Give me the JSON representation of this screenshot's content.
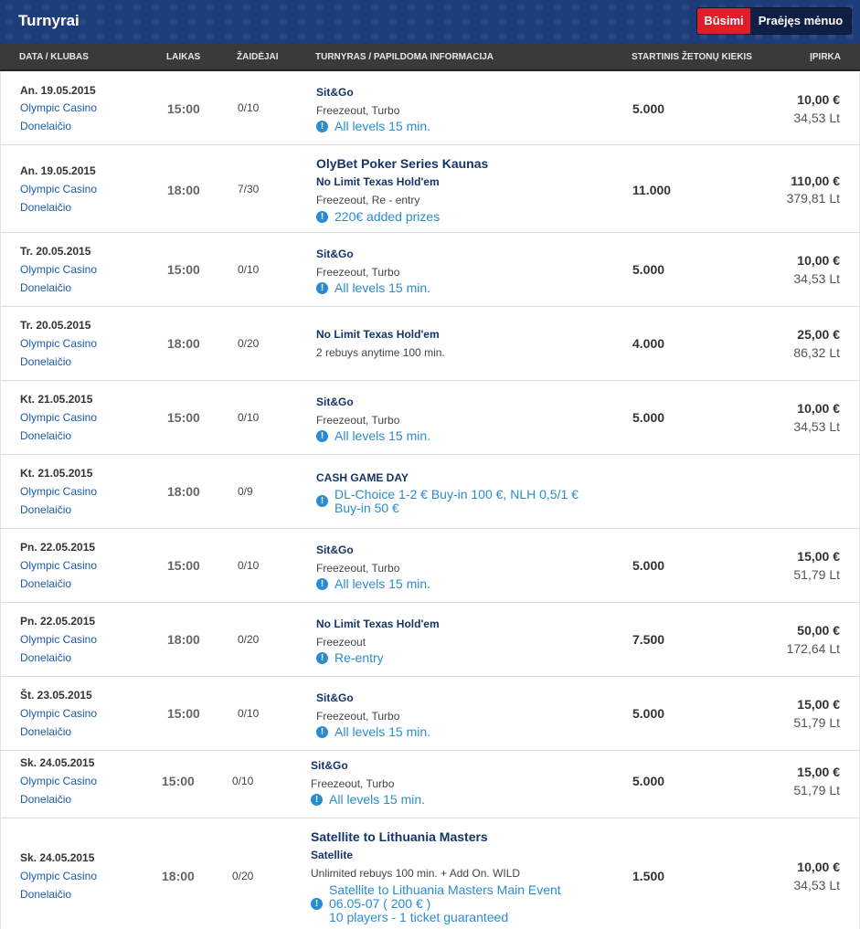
{
  "header": {
    "title": "Turnyrai",
    "tab_upcoming": "Būsimi",
    "tab_past": "Praėjęs mėnuo"
  },
  "columns": {
    "date_club": "DATA / KLUBAS",
    "time": "LAIKAS",
    "players": "ŽAIDĖJAI",
    "tournament": "TURNYRAS / PAPILDOMA INFORMACIJA",
    "chips": "STARTINIS ŽETONŲ KIEKIS",
    "buyin": "ĮPIRKA"
  },
  "rows": [
    {
      "date": "An. 19.05.2015",
      "club": "Olympic Casino",
      "street": "Donelaičio",
      "time": "15:00",
      "players": "0/10",
      "name": "Sit&Go",
      "details": "Freezeout, Turbo",
      "info": "All levels 15 min.",
      "chips": "5.000",
      "eur": "10,00 €",
      "lt": "34,53 Lt"
    },
    {
      "date": "An. 19.05.2015",
      "club": "Olympic Casino",
      "street": "Donelaičio",
      "time": "18:00",
      "players": "7/30",
      "big_title": "OlyBet Poker Series Kaunas",
      "name": "No Limit Texas Hold'em",
      "details": "Freezeout, Re - entry",
      "info": "220€ added prizes",
      "chips": "11.000",
      "eur": "110,00 €",
      "lt": "379,81 Lt"
    },
    {
      "date": "Tr. 20.05.2015",
      "club": "Olympic Casino",
      "street": "Donelaičio",
      "time": "15:00",
      "players": "0/10",
      "name": "Sit&Go",
      "details": "Freezeout, Turbo",
      "info": "All levels 15 min.",
      "chips": "5.000",
      "eur": "10,00 €",
      "lt": "34,53 Lt"
    },
    {
      "date": "Tr. 20.05.2015",
      "club": "Olympic Casino",
      "street": "Donelaičio",
      "time": "18:00",
      "players": "0/20",
      "name": "No Limit Texas Hold'em",
      "details": "2 rebuys anytime 100 min.",
      "chips": "4.000",
      "eur": "25,00 €",
      "lt": "86,32 Lt"
    },
    {
      "date": "Kt. 21.05.2015",
      "club": "Olympic Casino",
      "street": "Donelaičio",
      "time": "15:00",
      "players": "0/10",
      "name": "Sit&Go",
      "details": "Freezeout, Turbo",
      "info": "All levels 15 min.",
      "chips": "5.000",
      "eur": "10,00 €",
      "lt": "34,53 Lt"
    },
    {
      "date": "Kt. 21.05.2015",
      "club": "Olympic Casino",
      "street": "Donelaičio",
      "time": "18:00",
      "players": "0/9",
      "name": "CASH GAME DAY",
      "info_line1": "DL-Choice 1-2 € Buy-in 100 €, NLH 0,5/1 €",
      "info_line2": "Buy-in 50 €"
    },
    {
      "date": "Pn. 22.05.2015",
      "club": "Olympic Casino",
      "street": "Donelaičio",
      "time": "15:00",
      "players": "0/10",
      "name": "Sit&Go",
      "details": "Freezeout, Turbo",
      "info": "All levels 15 min.",
      "chips": "5.000",
      "eur": "15,00 €",
      "lt": "51,79 Lt"
    },
    {
      "date": "Pn. 22.05.2015",
      "club": "Olympic Casino",
      "street": "Donelaičio",
      "time": "18:00",
      "players": "0/20",
      "name": "No Limit Texas Hold'em",
      "details": "Freezeout",
      "info": "Re-entry",
      "chips": "7.500",
      "eur": "50,00 €",
      "lt": "172,64 Lt"
    },
    {
      "date": "Št. 23.05.2015",
      "club": "Olympic Casino",
      "street": "Donelaičio",
      "time": "15:00",
      "players": "0/10",
      "name": "Sit&Go",
      "details": "Freezeout, Turbo",
      "info": "All levels 15 min.",
      "chips": "5.000",
      "eur": "15,00 €",
      "lt": "51,79 Lt"
    },
    {
      "date": "Sk. 24.05.2015",
      "club": "Olympic Casino",
      "street": "Donelaičio",
      "time": "15:00",
      "players": "0/10",
      "name": "Sit&Go",
      "details": "Freezeout, Turbo",
      "info": "All levels 15 min.",
      "chips": "5.000",
      "eur": "15,00 €",
      "lt": "51,79 Lt"
    },
    {
      "date": "Sk. 24.05.2015",
      "club": "Olympic Casino",
      "street": "Donelaičio",
      "time": "18:00",
      "players": "0/20",
      "big_title": "Satellite to Lithuania Masters",
      "name": "Satellite",
      "details": "Unlimited rebuys 100 min. + Add On. WILD",
      "info_line1": "Satellite to Lithuania Masters Main Event",
      "info_line2": "06.05-07 ( 200 € )",
      "info_line3": "10 players - 1 ticket guaranteed",
      "chips": "1.500",
      "eur": "10,00 €",
      "lt": "34,53 Lt"
    }
  ]
}
